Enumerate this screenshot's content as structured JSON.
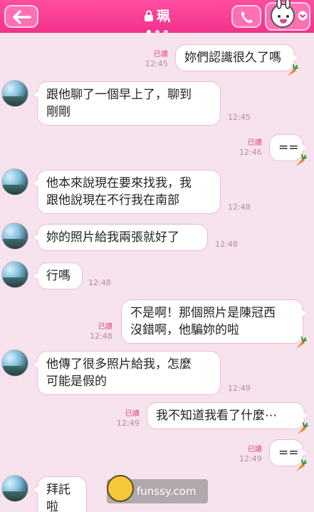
{
  "header": {
    "title": "珮",
    "page_dots": 3
  },
  "icons": {
    "back": "back-arrow-icon",
    "lock": "lock-icon",
    "phone": "phone-icon",
    "sticker": "bunny-sticker-icon"
  },
  "messages": [
    {
      "side": "right",
      "text": "妳們認識很久了嗎",
      "read": "已讀",
      "time": "12:45"
    },
    {
      "side": "left",
      "text": "跟他聊了一個早上了，聊到\n剛剛",
      "time": "12:45"
    },
    {
      "side": "right",
      "text": "==",
      "read": "已讀",
      "time": "12:46"
    },
    {
      "side": "left",
      "text": "他本來說現在要來找我，我\n跟他說現在不行我在南部",
      "time": "12:48"
    },
    {
      "side": "left",
      "text": "妳的照片給我兩張就好了",
      "time": "12:48"
    },
    {
      "side": "left",
      "text": "行嗎",
      "time": "12:48"
    },
    {
      "side": "right",
      "text": "不是啊！那個照片是陳冠西\n沒錯啊，他騙妳的啦",
      "read": "已讀",
      "time": "12:48"
    },
    {
      "side": "left",
      "text": "他傳了很多照片給我，怎麼\n可能是假的",
      "time": "12:49"
    },
    {
      "side": "right",
      "text": "我不知道我看了什麼⋯",
      "read": "已讀",
      "time": "12:49"
    },
    {
      "side": "right",
      "text": "==",
      "read": "已讀",
      "time": "12:49"
    },
    {
      "side": "left",
      "text": "拜託啦",
      "time": ""
    }
  ],
  "watermark": "funssy.com",
  "colors": {
    "header": "#f2338b",
    "background": "#f6e3ee",
    "read_receipt": "#e3447f"
  }
}
